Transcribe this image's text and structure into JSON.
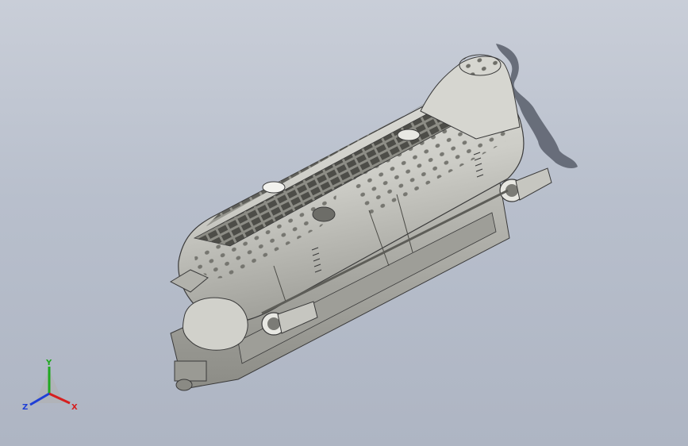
{
  "viewport": {
    "background_top": "#c9ced8",
    "background_bottom": "#aeb5c3"
  },
  "model": {
    "description_icon": "helicopter-fuselage-3d-model",
    "body_color": "#c9c9c4",
    "shadow_color": "#5e6470",
    "outline_color": "#3a3a3a"
  },
  "triad": {
    "x_label": "X",
    "y_label": "Y",
    "z_label": "Z",
    "x_color": "#d61f1f",
    "y_color": "#1fa81f",
    "z_color": "#1f3fd6"
  }
}
